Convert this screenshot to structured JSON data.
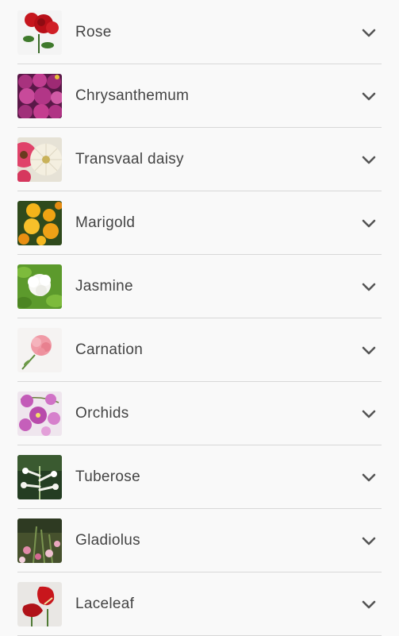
{
  "flowers": [
    {
      "name": "Rose",
      "icon": "rose-thumbnail-icon"
    },
    {
      "name": "Chrysanthemum",
      "icon": "chrysanthemum-thumbnail-icon"
    },
    {
      "name": "Transvaal daisy",
      "icon": "transvaal-daisy-thumbnail-icon"
    },
    {
      "name": "Marigold",
      "icon": "marigold-thumbnail-icon"
    },
    {
      "name": "Jasmine",
      "icon": "jasmine-thumbnail-icon"
    },
    {
      "name": "Carnation",
      "icon": "carnation-thumbnail-icon"
    },
    {
      "name": "Orchids",
      "icon": "orchids-thumbnail-icon"
    },
    {
      "name": "Tuberose",
      "icon": "tuberose-thumbnail-icon"
    },
    {
      "name": "Gladiolus",
      "icon": "gladiolus-thumbnail-icon"
    },
    {
      "name": "Laceleaf",
      "icon": "laceleaf-thumbnail-icon"
    }
  ],
  "colors": {
    "background": "#f9f9f9",
    "divider": "#d8d8d8",
    "text": "#444444",
    "chevron": "#555555"
  },
  "expand_icon": "chevron-down-icon"
}
